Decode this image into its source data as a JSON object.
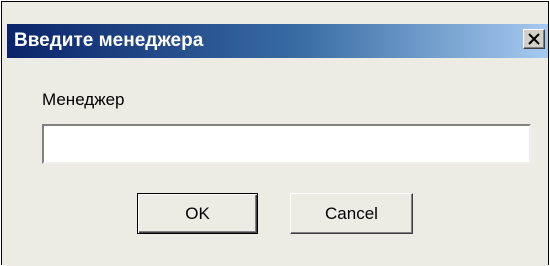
{
  "window": {
    "title": "Введите менеджера",
    "close_icon": "close-icon"
  },
  "form": {
    "manager_label": "Менеджер",
    "manager_value": "",
    "manager_placeholder": ""
  },
  "buttons": {
    "ok_label": "OK",
    "cancel_label": "Cancel"
  },
  "colors": {
    "titlebar_start": "#0a246a",
    "titlebar_end": "#a6caf0",
    "dialog_background": "#ecebe4"
  }
}
